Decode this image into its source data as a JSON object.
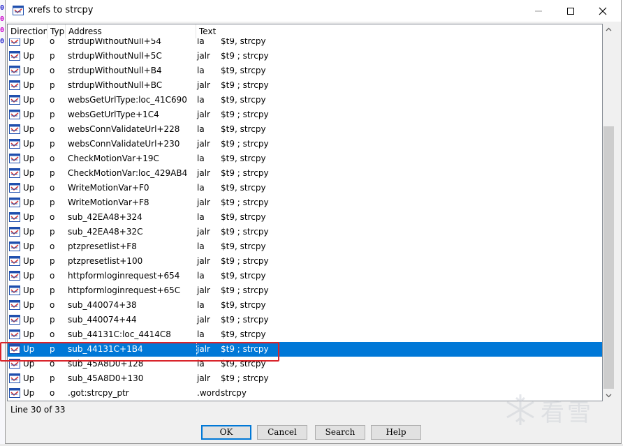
{
  "window": {
    "title": "xrefs to strcpy",
    "controls": {
      "minimize": "minimize",
      "maximize": "maximize",
      "close": "close"
    }
  },
  "table": {
    "columns": [
      "Direction",
      "Typ",
      "Address",
      "Text"
    ],
    "rows": [
      {
        "dir": "Up",
        "type": "o",
        "address": "strdupWithoutNull+54",
        "mnemonic": "la",
        "operands": "$t9, strcpy"
      },
      {
        "dir": "Up",
        "type": "p",
        "address": "strdupWithoutNull+5C",
        "mnemonic": "jalr",
        "operands": "$t9 ; strcpy"
      },
      {
        "dir": "Up",
        "type": "o",
        "address": "strdupWithoutNull+B4",
        "mnemonic": "la",
        "operands": "$t9, strcpy"
      },
      {
        "dir": "Up",
        "type": "p",
        "address": "strdupWithoutNull+BC",
        "mnemonic": "jalr",
        "operands": "$t9 ; strcpy"
      },
      {
        "dir": "Up",
        "type": "o",
        "address": "websGetUrlType:loc_41C690",
        "mnemonic": "la",
        "operands": "$t9, strcpy"
      },
      {
        "dir": "Up",
        "type": "p",
        "address": "websGetUrlType+1C4",
        "mnemonic": "jalr",
        "operands": "$t9 ; strcpy"
      },
      {
        "dir": "Up",
        "type": "o",
        "address": "websConnValidateUrl+228",
        "mnemonic": "la",
        "operands": "$t9, strcpy"
      },
      {
        "dir": "Up",
        "type": "p",
        "address": "websConnValidateUrl+230",
        "mnemonic": "jalr",
        "operands": "$t9 ; strcpy"
      },
      {
        "dir": "Up",
        "type": "o",
        "address": "CheckMotionVar+19C",
        "mnemonic": "la",
        "operands": "$t9, strcpy"
      },
      {
        "dir": "Up",
        "type": "p",
        "address": "CheckMotionVar:loc_429AB4",
        "mnemonic": "jalr",
        "operands": "$t9 ; strcpy"
      },
      {
        "dir": "Up",
        "type": "o",
        "address": "WriteMotionVar+F0",
        "mnemonic": "la",
        "operands": "$t9, strcpy"
      },
      {
        "dir": "Up",
        "type": "p",
        "address": "WriteMotionVar+F8",
        "mnemonic": "jalr",
        "operands": "$t9 ; strcpy"
      },
      {
        "dir": "Up",
        "type": "o",
        "address": "sub_42EA48+324",
        "mnemonic": "la",
        "operands": "$t9, strcpy"
      },
      {
        "dir": "Up",
        "type": "p",
        "address": "sub_42EA48+32C",
        "mnemonic": "jalr",
        "operands": "$t9 ; strcpy"
      },
      {
        "dir": "Up",
        "type": "o",
        "address": "ptzpresetlist+F8",
        "mnemonic": "la",
        "operands": "$t9, strcpy"
      },
      {
        "dir": "Up",
        "type": "p",
        "address": "ptzpresetlist+100",
        "mnemonic": "jalr",
        "operands": "$t9 ; strcpy"
      },
      {
        "dir": "Up",
        "type": "o",
        "address": "httpformloginrequest+654",
        "mnemonic": "la",
        "operands": "$t9, strcpy"
      },
      {
        "dir": "Up",
        "type": "p",
        "address": "httpformloginrequest+65C",
        "mnemonic": "jalr",
        "operands": "$t9 ; strcpy"
      },
      {
        "dir": "Up",
        "type": "o",
        "address": "sub_440074+38",
        "mnemonic": "la",
        "operands": "$t9, strcpy"
      },
      {
        "dir": "Up",
        "type": "p",
        "address": "sub_440074+44",
        "mnemonic": "jalr",
        "operands": "$t9 ; strcpy"
      },
      {
        "dir": "Up",
        "type": "o",
        "address": "sub_44131C:loc_4414C8",
        "mnemonic": "la",
        "operands": "$t9, strcpy"
      },
      {
        "dir": "Up",
        "type": "p",
        "address": "sub_44131C+1B4",
        "mnemonic": "jalr",
        "operands": "$t9 ; strcpy",
        "selected": true
      },
      {
        "dir": "Up",
        "type": "o",
        "address": "sub_45A8D0+128",
        "mnemonic": "la",
        "operands": "$t9, strcpy"
      },
      {
        "dir": "Up",
        "type": "p",
        "address": "sub_45A8D0+130",
        "mnemonic": "jalr",
        "operands": "$t9 ; strcpy"
      },
      {
        "dir": "Up",
        "type": "o",
        "address": ".got:strcpy_ptr",
        "mnemonic": ".word",
        "operands": "strcpy"
      }
    ]
  },
  "status": {
    "text": "Line 30 of 33"
  },
  "buttons": {
    "ok": "OK",
    "cancel": "Cancel",
    "search": "Search",
    "help": "Help"
  },
  "watermark": {
    "text": "看雪"
  },
  "colors": {
    "selection": "#0078d7",
    "annotation": "#d9242b",
    "icon_blue": "#1f4fae"
  }
}
